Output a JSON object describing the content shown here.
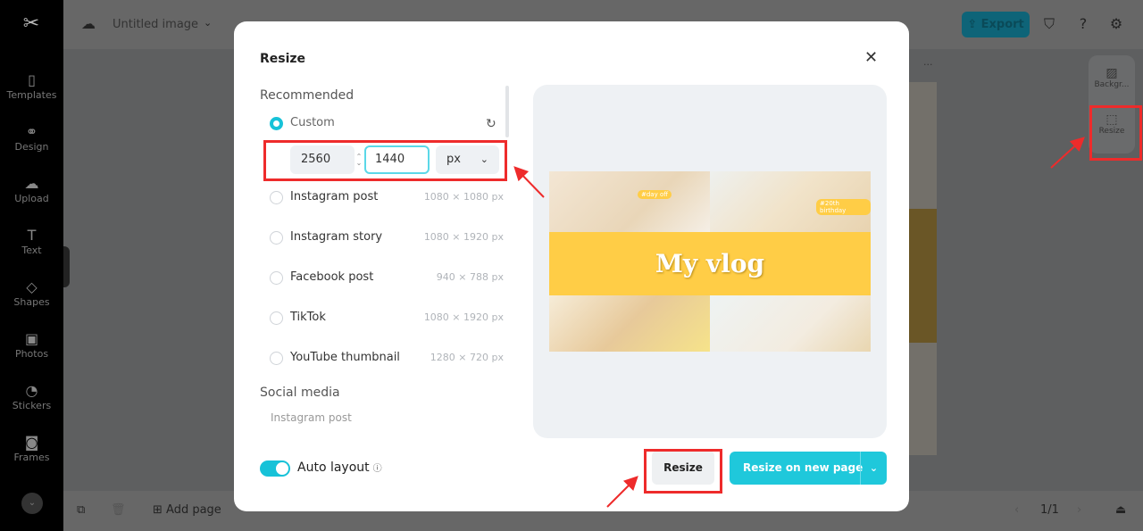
{
  "sidebar": {
    "items": [
      {
        "label": "Templates",
        "icon": "templates-icon"
      },
      {
        "label": "Design",
        "icon": "design-icon"
      },
      {
        "label": "Upload",
        "icon": "upload-icon"
      },
      {
        "label": "Text",
        "icon": "text-icon"
      },
      {
        "label": "Shapes",
        "icon": "shapes-icon"
      },
      {
        "label": "Photos",
        "icon": "photos-icon"
      },
      {
        "label": "Stickers",
        "icon": "stickers-icon"
      },
      {
        "label": "Frames",
        "icon": "frames-icon"
      }
    ]
  },
  "topbar": {
    "title": "Untitled image",
    "export": "Export"
  },
  "right_panel": {
    "background": "Backgr...",
    "resize": "Resize"
  },
  "bottombar": {
    "add_page": "Add page",
    "page": "1/1"
  },
  "modal": {
    "title": "Resize",
    "recommended": "Recommended",
    "custom": "Custom",
    "width": "2560",
    "height": "1440",
    "unit": "px",
    "options": [
      {
        "label": "Instagram post",
        "size": "1080 × 1080 px"
      },
      {
        "label": "Instagram story",
        "size": "1080 × 1920 px"
      },
      {
        "label": "Facebook post",
        "size": "940 × 788 px"
      },
      {
        "label": "TikTok",
        "size": "1080 × 1920 px"
      },
      {
        "label": "YouTube thumbnail",
        "size": "1280 × 720 px"
      }
    ],
    "social_media": "Social media",
    "social_first": "Instagram post",
    "auto_layout": "Auto layout",
    "auto_layout_on": true,
    "preview": {
      "title": "My vlog",
      "tag1": "#day off",
      "tag2": "#20th birthday"
    },
    "resize_btn": "Resize",
    "resize_new_btn": "Resize on new page"
  },
  "colors": {
    "accent": "#1fc8db",
    "annotation": "#ee2b2b"
  }
}
